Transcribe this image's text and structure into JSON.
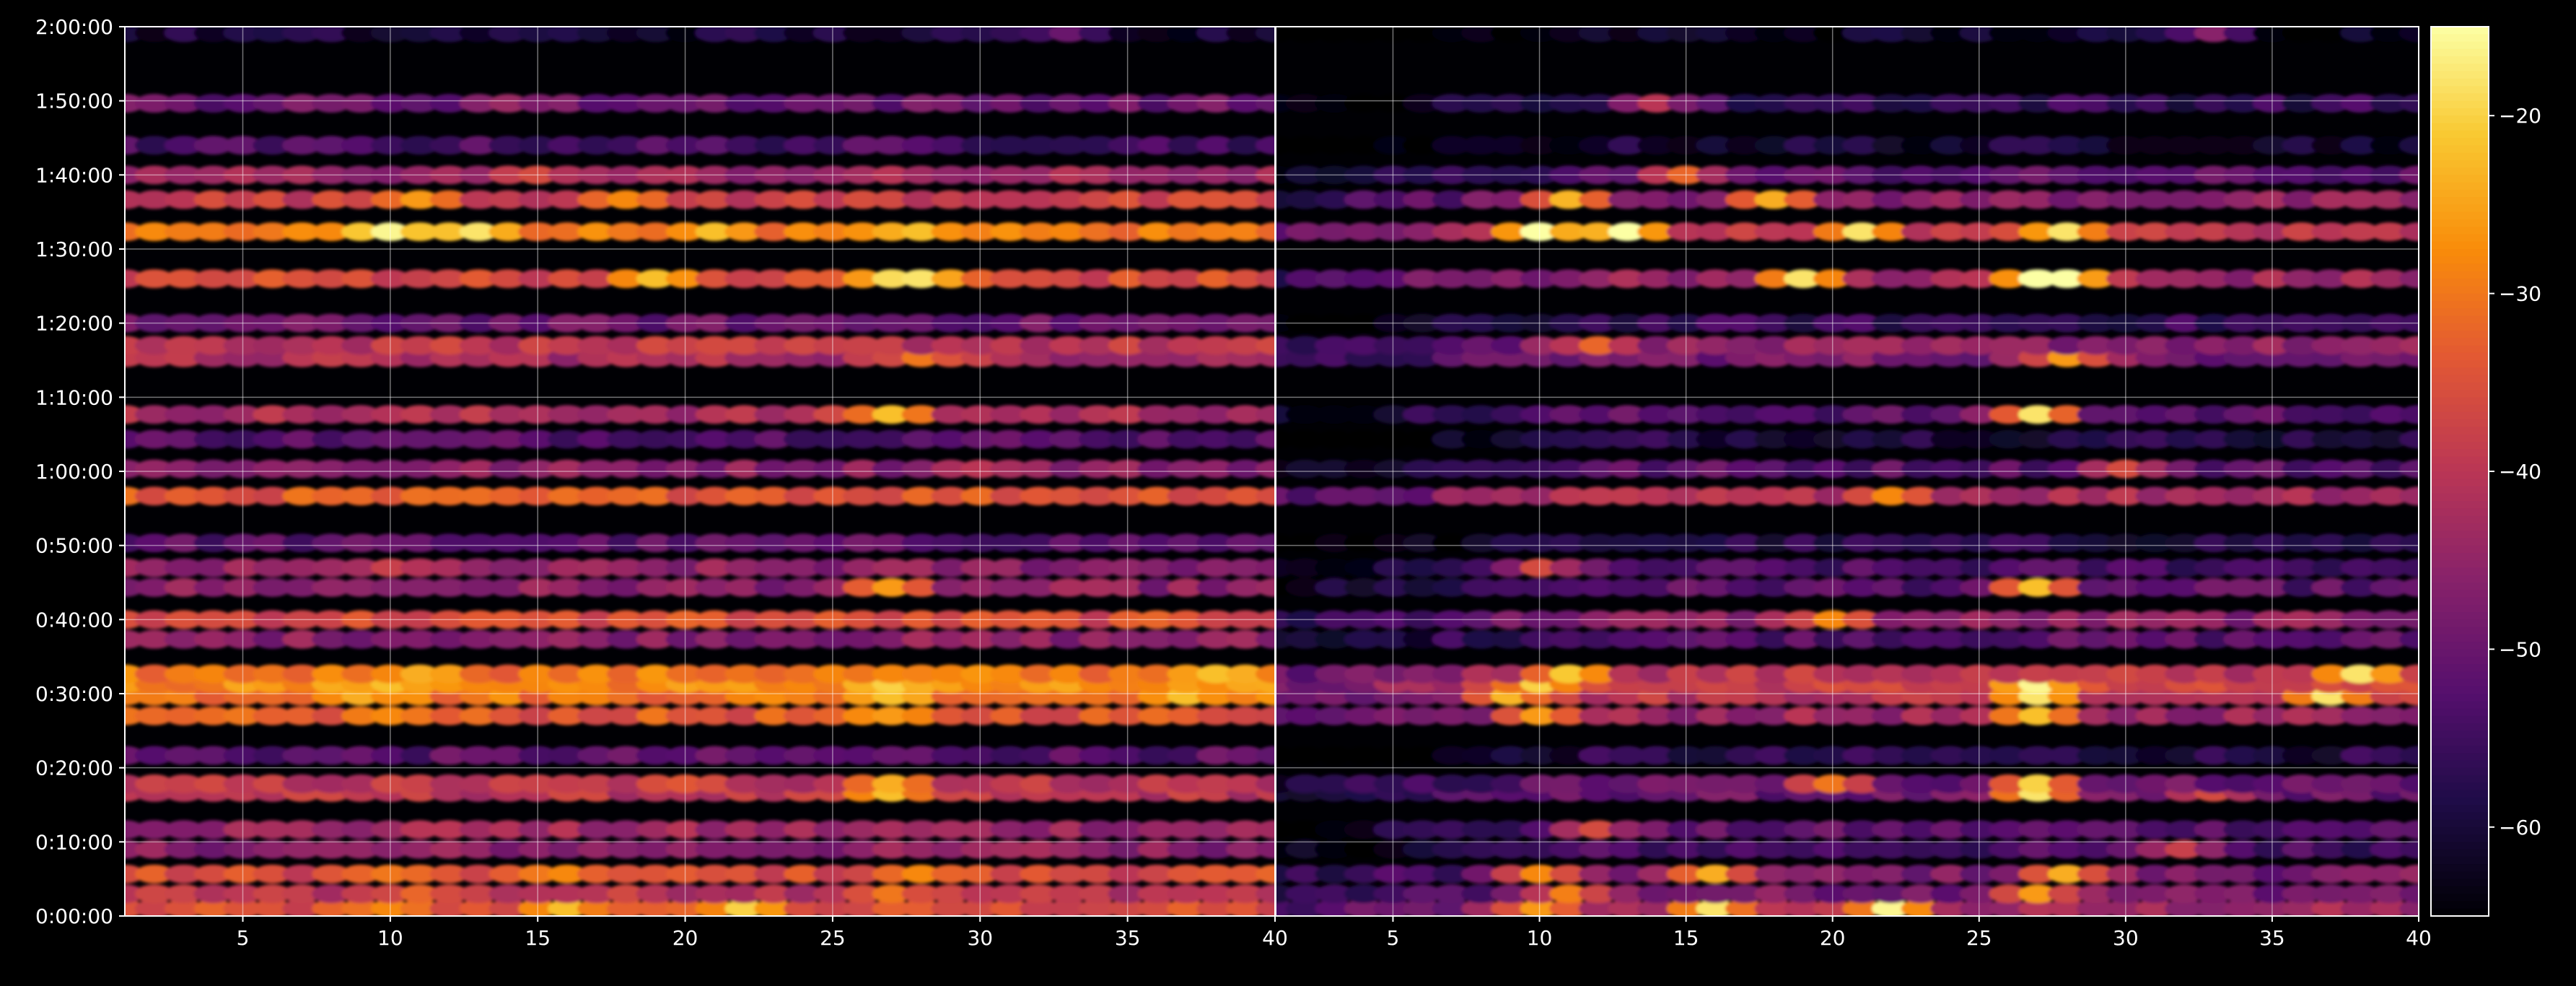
{
  "chart_data": {
    "type": "heatmap",
    "title": "",
    "xlabel": "",
    "ylabel": "",
    "panels": [
      {
        "name": "",
        "xlim": [
          1,
          40
        ],
        "x_ticks": [
          5,
          10,
          15,
          20,
          25,
          30,
          35,
          40
        ]
      },
      {
        "name": "",
        "xlim": [
          1,
          40
        ],
        "x_ticks": [
          5,
          10,
          15,
          20,
          25,
          30,
          35,
          40
        ]
      }
    ],
    "y_axis": {
      "unit": "seconds",
      "ylim": [
        0,
        7200
      ],
      "ticks": [
        {
          "value": 0,
          "label": "0:00:00"
        },
        {
          "value": 600,
          "label": "0:10:00"
        },
        {
          "value": 1200,
          "label": "0:20:00"
        },
        {
          "value": 1800,
          "label": "0:30:00"
        },
        {
          "value": 2400,
          "label": "0:40:00"
        },
        {
          "value": 3000,
          "label": "0:50:00"
        },
        {
          "value": 3600,
          "label": "1:00:00"
        },
        {
          "value": 4200,
          "label": "1:10:00"
        },
        {
          "value": 4800,
          "label": "1:20:00"
        },
        {
          "value": 5400,
          "label": "1:30:00"
        },
        {
          "value": 6000,
          "label": "1:40:00"
        },
        {
          "value": 6600,
          "label": "1:50:00"
        },
        {
          "value": 7200,
          "label": "2:00:00"
        }
      ]
    },
    "colorbar": {
      "colormap": "inferno",
      "range": [
        -65,
        -15
      ],
      "ticks": [
        {
          "value": -20,
          "label": "−20"
        },
        {
          "value": -30,
          "label": "−30"
        },
        {
          "value": -40,
          "label": "−40"
        },
        {
          "value": -50,
          "label": "−50"
        },
        {
          "value": -60,
          "label": "−60"
        }
      ]
    },
    "grid": true,
    "bands": [
      {
        "y": 60,
        "left": -36,
        "right": -44,
        "peaks": [
          [
            10,
            -28
          ],
          [
            16,
            -22
          ],
          [
            22,
            -20
          ]
        ]
      },
      {
        "y": 180,
        "left": -40,
        "right": -48,
        "peaks": [
          [
            11,
            -32
          ],
          [
            27,
            -30
          ]
        ]
      },
      {
        "y": 340,
        "left": -36,
        "right": -48,
        "peaks": [
          [
            10,
            -30
          ],
          [
            16,
            -28
          ],
          [
            28,
            -28
          ]
        ]
      },
      {
        "y": 540,
        "left": -46,
        "right": -54,
        "peaks": [
          [
            32,
            -42
          ]
        ]
      },
      {
        "y": 700,
        "left": -44,
        "right": -52,
        "peaks": [
          [
            12,
            -40
          ]
        ]
      },
      {
        "y": 1000,
        "left": -40,
        "right": -50,
        "peaks": [
          [
            27,
            -22
          ],
          [
            33,
            -40
          ]
        ]
      },
      {
        "y": 1070,
        "left": -40,
        "right": -50,
        "peaks": [
          [
            27,
            -24
          ],
          [
            20,
            -34
          ]
        ]
      },
      {
        "y": 1300,
        "left": -52,
        "right": -58,
        "peaks": []
      },
      {
        "y": 1620,
        "left": -34,
        "right": -44,
        "peaks": [
          [
            10,
            -28
          ],
          [
            27,
            -26
          ]
        ]
      },
      {
        "y": 1780,
        "left": -30,
        "right": -40,
        "peaks": [
          [
            9,
            -24
          ],
          [
            27,
            -22
          ],
          [
            37,
            -22
          ]
        ]
      },
      {
        "y": 1880,
        "left": -28,
        "right": -38,
        "peaks": [
          [
            10,
            -22
          ],
          [
            27,
            -20
          ]
        ]
      },
      {
        "y": 1960,
        "left": -30,
        "right": -40,
        "peaks": [
          [
            11,
            -24
          ],
          [
            38,
            -22
          ]
        ]
      },
      {
        "y": 2240,
        "left": -46,
        "right": -52,
        "peaks": []
      },
      {
        "y": 2400,
        "left": -36,
        "right": -46,
        "peaks": [
          [
            20,
            -32
          ]
        ]
      },
      {
        "y": 2660,
        "left": -46,
        "right": -52,
        "peaks": [
          [
            27,
            -26
          ]
        ]
      },
      {
        "y": 2820,
        "left": -46,
        "right": -54,
        "peaks": [
          [
            10,
            -38
          ]
        ]
      },
      {
        "y": 3020,
        "left": -52,
        "right": -58,
        "peaks": []
      },
      {
        "y": 3400,
        "left": -34,
        "right": -42,
        "peaks": [
          [
            22,
            -32
          ]
        ]
      },
      {
        "y": 3620,
        "left": -46,
        "right": -52,
        "peaks": [
          [
            30,
            -40
          ]
        ]
      },
      {
        "y": 3860,
        "left": -52,
        "right": -58,
        "peaks": []
      },
      {
        "y": 4060,
        "left": -42,
        "right": -52,
        "peaks": [
          [
            27,
            -22
          ]
        ]
      },
      {
        "y": 4520,
        "left": -42,
        "right": -48,
        "peaks": [
          [
            28,
            -30
          ]
        ]
      },
      {
        "y": 4620,
        "left": -40,
        "right": -46,
        "peaks": [
          [
            12,
            -36
          ]
        ]
      },
      {
        "y": 4800,
        "left": -50,
        "right": -56,
        "peaks": []
      },
      {
        "y": 5160,
        "left": -36,
        "right": -44,
        "peaks": [
          [
            19,
            -22
          ],
          [
            27,
            -20
          ],
          [
            28,
            -18
          ]
        ]
      },
      {
        "y": 5540,
        "left": -30,
        "right": -40,
        "peaks": [
          [
            10,
            -16
          ],
          [
            13,
            -18
          ],
          [
            21,
            -22
          ],
          [
            28,
            -22
          ]
        ]
      },
      {
        "y": 5800,
        "left": -38,
        "right": -46,
        "peaks": [
          [
            11,
            -26
          ],
          [
            18,
            -28
          ]
        ]
      },
      {
        "y": 6000,
        "left": -44,
        "right": -52,
        "peaks": [
          [
            15,
            -36
          ]
        ]
      },
      {
        "y": 6240,
        "left": -54,
        "right": -60,
        "peaks": []
      },
      {
        "y": 6580,
        "left": -50,
        "right": -56,
        "peaks": [
          [
            14,
            -44
          ]
        ]
      },
      {
        "y": 7150,
        "left": -60,
        "right": -62,
        "peaks": [
          [
            33,
            -50
          ]
        ]
      }
    ]
  }
}
